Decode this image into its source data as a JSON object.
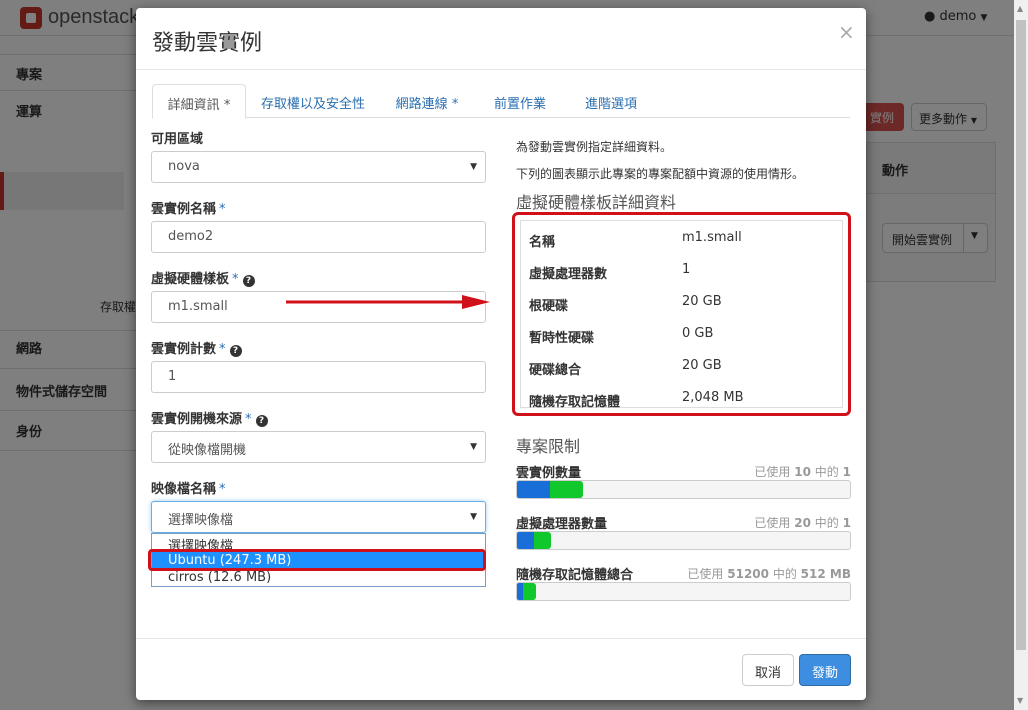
{
  "app": {
    "logo_text": "openstack",
    "user": "demo",
    "sidebar": {
      "project": "專案",
      "compute": "運算",
      "sub_label": "存取權",
      "network": "網路",
      "object_store": "物件式儲存空間",
      "identity": "身份"
    },
    "actions": {
      "red_button": "實例",
      "more_actions": "更多動作",
      "column_action": "動作",
      "launch_instance_btn": "開始雲實例"
    }
  },
  "modal": {
    "title": "發動雲實例",
    "close_glyph": "×",
    "tabs": [
      {
        "label": "詳細資訊",
        "required": "*"
      },
      {
        "label": "存取權以及安全性",
        "required": ""
      },
      {
        "label": "網路連線",
        "required": "*"
      },
      {
        "label": "前置作業",
        "required": ""
      },
      {
        "label": "進階選項",
        "required": ""
      }
    ],
    "form": {
      "availability_zone": {
        "label": "可用區域",
        "value": "nova"
      },
      "instance_name": {
        "label": "雲實例名稱",
        "value": "demo2"
      },
      "flavor": {
        "label": "虛擬硬體樣板",
        "value": "m1.small"
      },
      "instance_count": {
        "label": "雲實例計數",
        "value": "1"
      },
      "boot_source": {
        "label": "雲實例開機來源",
        "value": "從映像檔開機"
      },
      "image_name": {
        "label": "映像檔名稱",
        "value": "選擇映像檔",
        "options": [
          "選擇映像檔",
          "Ubuntu (247.3 MB)",
          "cirros (12.6 MB)"
        ],
        "highlighted_option": "Ubuntu (247.3 MB)"
      },
      "required_mark": "*",
      "help_glyph": "?"
    },
    "info": {
      "line1": "為發動雲實例指定詳細資料。",
      "line2": "下列的圖表顯示此專案的專案配額中資源的使用情形。"
    },
    "flavor_details": {
      "title": "虛擬硬體樣板詳細資料",
      "rows": [
        {
          "key": "名稱",
          "value": "m1.small"
        },
        {
          "key": "虛擬處理器數",
          "value": "1"
        },
        {
          "key": "根硬碟",
          "value": "20 GB"
        },
        {
          "key": "暫時性硬碟",
          "value": "0 GB"
        },
        {
          "key": "硬碟總合",
          "value": "20 GB"
        },
        {
          "key": "隨機存取記憶體",
          "value": "2,048 MB"
        }
      ]
    },
    "project_limits": {
      "title": "專案限制",
      "quotas": [
        {
          "label": "雲實例數量",
          "used_text_pre": "已使用",
          "total": "10",
          "used_text_mid": "中的",
          "used": "1",
          "used_fraction": 0.1,
          "added_fraction": 0.1
        },
        {
          "label": "虛擬處理器數量",
          "used_text_pre": "已使用",
          "total": "20",
          "used_text_mid": "中的",
          "used": "1",
          "used_fraction": 0.05,
          "added_fraction": 0.05
        },
        {
          "label": "隨機存取記憶體總合",
          "used_text_pre": "已使用",
          "total": "51200",
          "used_text_mid": "中的",
          "used": "512 MB",
          "used_fraction": 0.01,
          "added_fraction": 0.04
        }
      ]
    },
    "buttons": {
      "cancel": "取消",
      "launch": "發動"
    }
  },
  "colors": {
    "accent_red": "#d1111a",
    "primary_blue": "#3d8ee0",
    "quota_blue": "#1a6ed8",
    "quota_green": "#11c82c"
  }
}
